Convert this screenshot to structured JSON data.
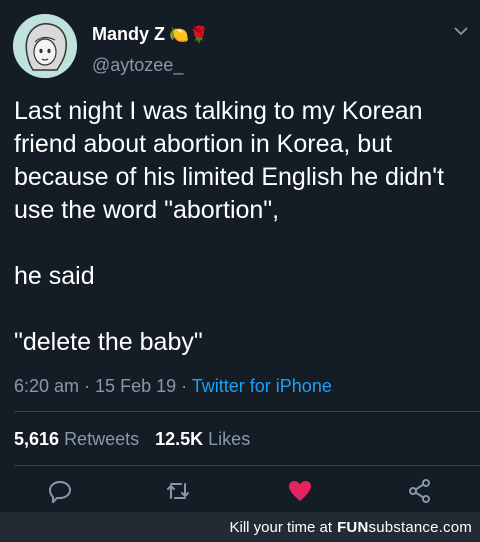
{
  "user": {
    "display_name": "Mandy Z",
    "emojis": "🍋🌹",
    "handle": "@aytozee_",
    "avatar_icon": "cartoon-avatar-icon"
  },
  "tweet": {
    "lines_1": "Last night I was talking to my Korean friend about abortion in Korea, but because of his limited English he didn't use the word \"abortion\",",
    "lines_2": "he said",
    "lines_3": "\"delete the baby\""
  },
  "meta": {
    "time": "6:20 am",
    "sep1": " · ",
    "date": "15 Feb 19",
    "sep2": " · ",
    "source": "Twitter for iPhone"
  },
  "stats": {
    "retweets_count": "5,616",
    "retweets_label": "Retweets",
    "likes_count": "12.5K",
    "likes_label": "Likes"
  },
  "actions": {
    "reply_icon": "reply-icon",
    "retweet_icon": "retweet-icon",
    "like_icon": "heart-icon",
    "share_icon": "share-icon",
    "like_color": "#e0245e"
  },
  "footer": {
    "text": "Kill your time at",
    "brand_main": "FUN",
    "brand_sub": "substance",
    "brand_tld": ".com"
  }
}
